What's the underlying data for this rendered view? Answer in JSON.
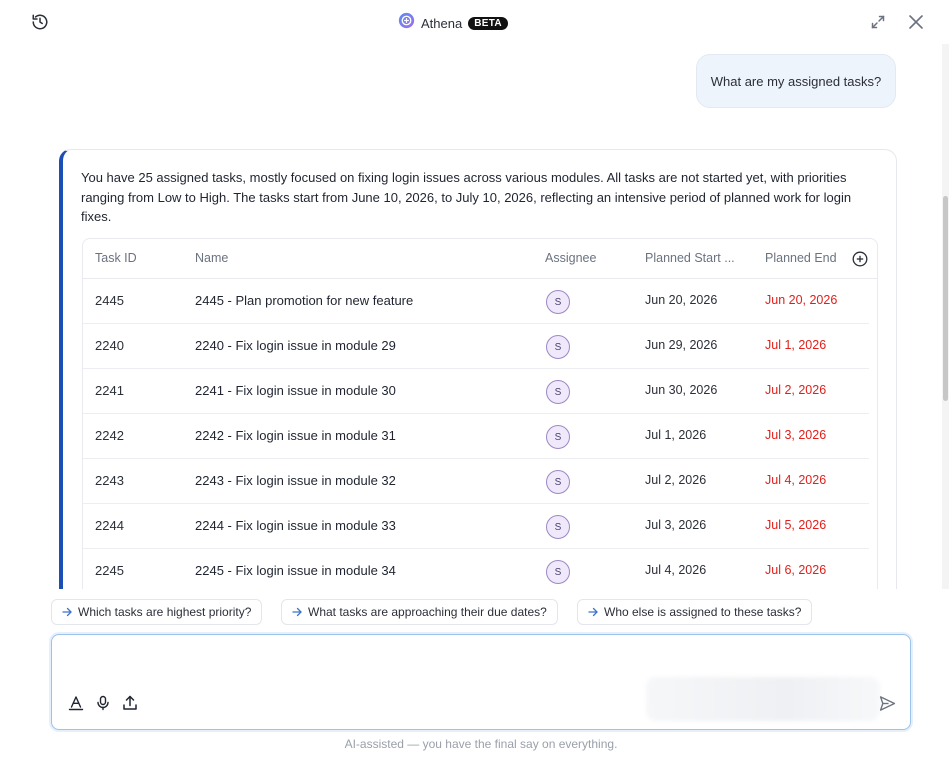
{
  "header": {
    "title": "Athena",
    "badge": "BETA",
    "icons": {
      "history": "history-icon",
      "expand": "expand-icon",
      "close": "close-icon",
      "logo": "athena-logo-icon"
    }
  },
  "colors": {
    "accent": "#1c4fb6",
    "overdue": "#e0201b",
    "user_bubble": "#eef4fb",
    "composer_border": "#9cc3ea"
  },
  "conversation": {
    "user_message": "What are my assigned tasks?",
    "answer_text": "You have 25 assigned tasks, mostly focused on fixing login issues across various modules. All tasks are not started yet, with priorities ranging from Low to High. The tasks start from June 10, 2026, to July 10, 2026, reflecting an intensive period of planned work for login fixes."
  },
  "table": {
    "columns": {
      "id": "Task ID",
      "name": "Name",
      "assignee": "Assignee",
      "start": "Planned Start ...",
      "end": "Planned End"
    },
    "rows": [
      {
        "id": "2445",
        "name": "2445 - Plan promotion for new feature",
        "assignee": "S",
        "start": "Jun 20, 2026",
        "end": "Jun 20, 2026"
      },
      {
        "id": "2240",
        "name": "2240 - Fix login issue in module 29",
        "assignee": "S",
        "start": "Jun 29, 2026",
        "end": "Jul 1, 2026"
      },
      {
        "id": "2241",
        "name": "2241 - Fix login issue in module 30",
        "assignee": "S",
        "start": "Jun 30, 2026",
        "end": "Jul 2, 2026"
      },
      {
        "id": "2242",
        "name": "2242 - Fix login issue in module 31",
        "assignee": "S",
        "start": "Jul 1, 2026",
        "end": "Jul 3, 2026"
      },
      {
        "id": "2243",
        "name": "2243 - Fix login issue in module 32",
        "assignee": "S",
        "start": "Jul 2, 2026",
        "end": "Jul 4, 2026"
      },
      {
        "id": "2244",
        "name": "2244 - Fix login issue in module 33",
        "assignee": "S",
        "start": "Jul 3, 2026",
        "end": "Jul 5, 2026"
      },
      {
        "id": "2245",
        "name": "2245 - Fix login issue in module 34",
        "assignee": "S",
        "start": "Jul 4, 2026",
        "end": "Jul 6, 2026"
      }
    ]
  },
  "suggestions": [
    "Which tasks are highest priority?",
    "What tasks are approaching their due dates?",
    "Who else is assigned to these tasks?"
  ],
  "composer": {
    "value": "",
    "placeholder": "",
    "tools": [
      "text-format-icon",
      "microphone-icon",
      "upload-icon"
    ],
    "send_icon": "send-icon"
  },
  "footer": {
    "disclaimer": "AI-assisted — you have the final say on everything."
  }
}
